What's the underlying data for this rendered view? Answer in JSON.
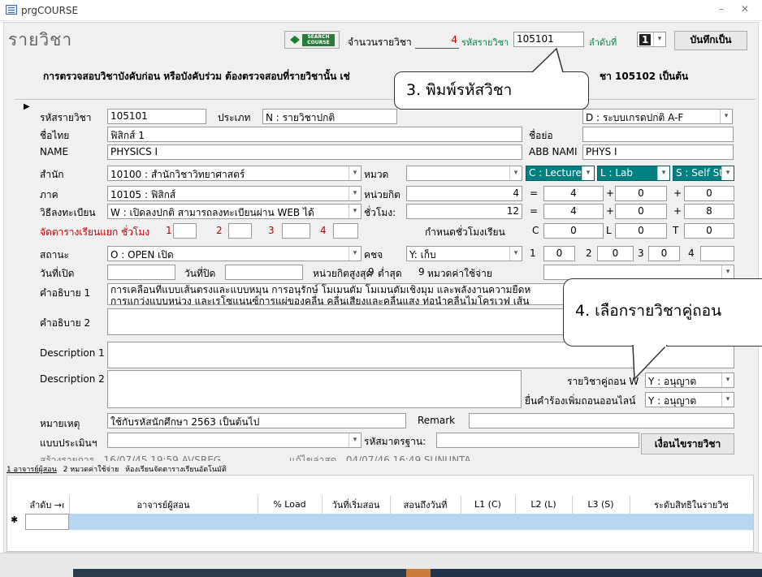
{
  "window": {
    "title": "prgCOURSE",
    "minimize": "–",
    "close": "✕"
  },
  "header": {
    "form_title": "รายวิชา",
    "search_btn_line1": "SEARCH",
    "search_btn_line2": "COURSE",
    "count_label": "จำนวนรายวิชา",
    "count_value": "4",
    "code_label": "รหัสรายวิชา",
    "code_value": "105101",
    "order_label": "ลำดับที่",
    "order_value": "1",
    "save_label": "บันทึกเป็น",
    "note_left": "การตรวจสอบวิชาบังคับก่อน หรือบังคับร่วม ต้องตรวจสอบที่รายวิชานั้น เช่",
    "note_right": "ชา 105102 เป็นต้น"
  },
  "callouts": {
    "c3": "3.  พิมพ์รหัสวิชา",
    "c4": "4.  เลือกรายวิชาคู่ถอน"
  },
  "fields": {
    "code_label": "รหัสรายวิชา",
    "code": "105101",
    "type_label": "ประเภท",
    "type": "N : รายวิชาปกติ",
    "grade": "D : ระบบเกรดปกติ  A-F",
    "thai_name_label": "ชื่อไทย",
    "thai_name": "ฟิสิกส์ 1",
    "abbr_label": "ชื่อย่อ",
    "abbr": "",
    "name_label": "NAME",
    "name": "PHYSICS I",
    "abb_name_label": "ABB NAMI",
    "abb_name": "PHYS I",
    "office_label": "สำนัก",
    "office": "10100 : สำนักวิชาวิทยาศาสตร์",
    "category_label": "หมวด",
    "category": "",
    "lecture": "C : Lecture",
    "lab": "L : Lab",
    "self": "S : Self St",
    "dept_label": "ภาค",
    "dept": "10105 : ฟิสิกส์",
    "credit_label": "หน่วยกิต",
    "credit": "4",
    "credit_c": "4",
    "credit_l": "0",
    "credit_s": "0",
    "reg_label": "วิธีลงทะเบียน",
    "reg": "W : เปิดลงปกติ สามารถลงทะเบียนผ่าน WEB ได้",
    "hours_label": "ชั่วโมง:",
    "hours": "12",
    "hours_c": "4",
    "hours_l": "0",
    "hours_s": "8",
    "sched_label": "จัดตารางเรียนแยก ชั่วโมง",
    "sched_1": "1",
    "sched_2": "2",
    "sched_3": "3",
    "sched_4": "4",
    "set_hours_label": "กำหนดชั่วโมงเรียน",
    "set_c_label": "C",
    "set_c": "0",
    "set_l_label": "L",
    "set_l": "0",
    "set_t_label": "T",
    "set_t": "0",
    "status_label": "สถานะ",
    "status": "O : OPEN เปิด",
    "kpc_label": "คชจ",
    "kpc": "Y: เก็บ",
    "n1_label": "1",
    "n1": "0",
    "n2_label": "2",
    "n2": "0",
    "n3_label": "3",
    "n3": "0",
    "n4_label": "4",
    "n4": "",
    "open_date_label": "วันที่เปิด",
    "close_date_label": "วันที่ปิด",
    "max_credit_label": "หน่วยกิตสูงสุด",
    "max_credit": "9",
    "min_label": "ต่ำสุด",
    "min_credit": "9",
    "expense_label": "หมวดค่าใช้จ่าย",
    "desc1_label": "คำอธิบาย 1",
    "desc1_line1": "การเคลื่อนที่แบบเส้นตรงและแบบหมุน การอนุรักษ์ โมเมนตัม โมเมนตัมเชิงมุม และพลังงานความยืดห",
    "desc1_line2": "การแกว่งแบบหน่วง และเรโซแนนซ์การแผ่ของคลื่น คลื่นเสียงและคลื่นแสง ท่อนำคลื่นไมโครเวฟ เส้น",
    "desc2_label": "คำอธิบาย 2",
    "edesc1_label": "Description 1",
    "edesc2_label": "Description 2",
    "withdraw_label": "รายวิชาคู่ถอน W",
    "withdraw": "Y : อนุญาต",
    "online_label": "ยื่นคำร้องเพิ่มถอนออนไลน์",
    "online": "Y : อนุญาต",
    "remark_th_label": "หมายเหตุ",
    "remark_th": "ใช้กับรหัสนักศึกษา 2563 เป็นต้นไป",
    "remark_label": "Remark",
    "eval_label": "แบบประเมินฯ",
    "std_label": "รหัสมาตรฐาน:",
    "condition_button": "เงื่อนไขรายวิชา",
    "created_label": "สร้างรายการ",
    "created": "16/07/45 19:59 AVSREG",
    "modified_label": "แก้ไขล่าสุด",
    "modified": "04/07/46 16:49 SUNUNTA"
  },
  "tabs": [
    "1 อาจารย์ผู้สอน",
    "2 หมวดค่าใช้จ่าย",
    "ห้องเรียนจัดตารางเรียนอัตโนมัติ"
  ],
  "grid": {
    "columns": [
      "ลำดับ →ı",
      "อาจารย์ผู้สอน",
      "% Load",
      "วันที่เริ่มสอน",
      "สอนถึงวันที่",
      "L1 (C)",
      "L2 (L)",
      "L3 (S)",
      "ระดับสิทธิในรายวิช"
    ],
    "new_row_marker": "✱"
  }
}
